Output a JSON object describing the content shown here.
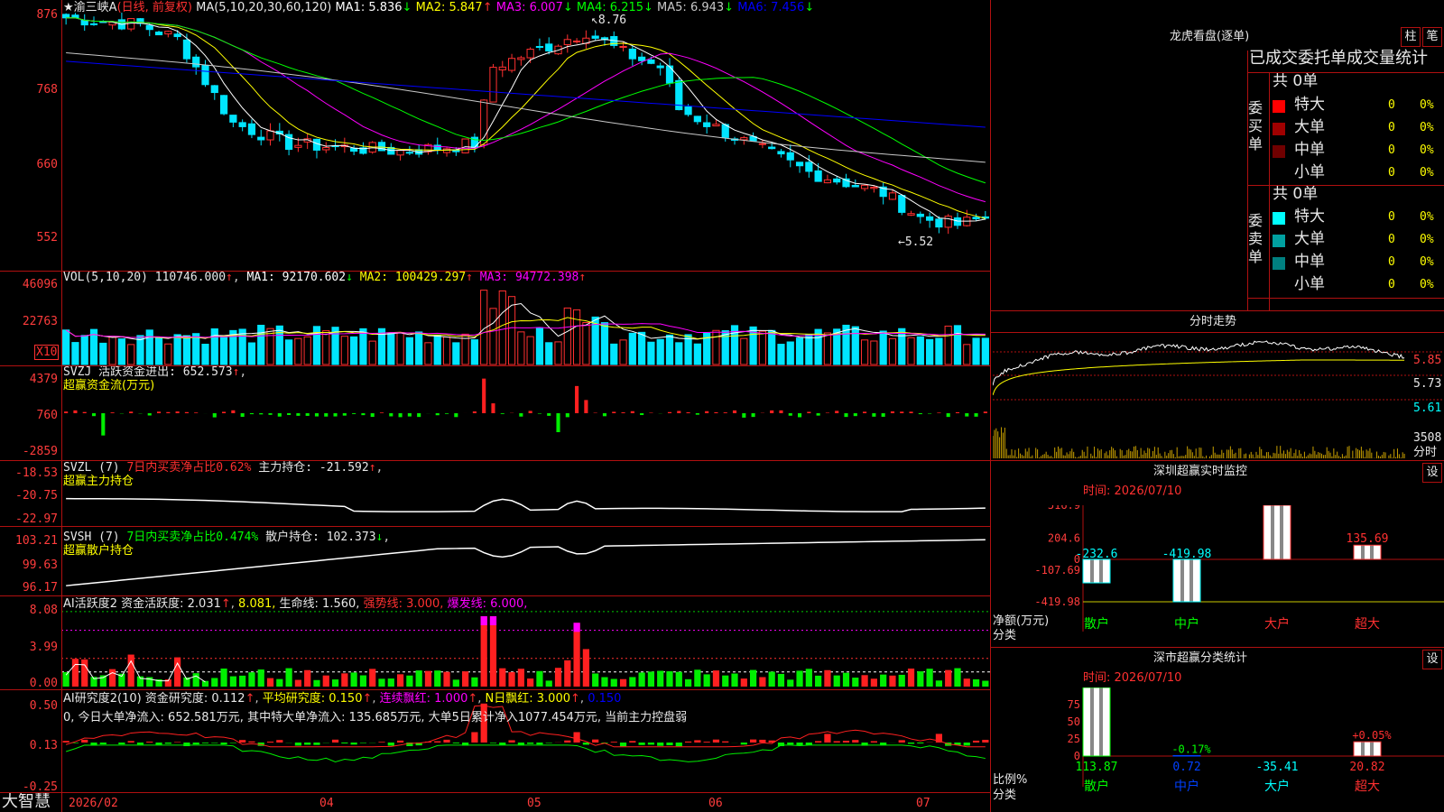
{
  "main": {
    "stock_title": "★渝三峡A",
    "period": "(日线, 前复权)",
    "ma_label": "MA(5,10,20,30,60,120)",
    "ma_values": [
      {
        "label": "MA1: 5.836",
        "arrow": "↓",
        "color": "#ffffff"
      },
      {
        "label": "MA2: 5.847",
        "arrow": "↑",
        "color": "#ffff00"
      },
      {
        "label": "MA3: 6.007",
        "arrow": "↓",
        "color": "#ff00ff"
      },
      {
        "label": "MA4: 6.215",
        "arrow": "↓",
        "color": "#00ff00"
      },
      {
        "label": "MA5: 6.943",
        "arrow": "↓",
        "color": "#c8c8c8"
      },
      {
        "label": "MA6: 7.456",
        "arrow": "↓",
        "color": "#0000ff"
      }
    ],
    "y_ticks": [
      "876",
      "768",
      "660",
      "552"
    ],
    "high_marker": "8.76",
    "low_marker": "5.52"
  },
  "vol": {
    "label": "VOL(5,10,20)",
    "value": "110746.000",
    "ma": [
      {
        "label": "MA1: 92170.602",
        "arrow": "↓",
        "color": "#ffffff"
      },
      {
        "label": "MA2: 100429.297",
        "arrow": "↑",
        "color": "#ffff00"
      },
      {
        "label": "MA3: 94772.398",
        "arrow": "↑",
        "color": "#ff00ff"
      }
    ],
    "y_ticks": [
      "46096",
      "22763"
    ],
    "unit": "X10"
  },
  "svzj": {
    "label": "SVZJ",
    "text": "活跃资金进出: 652.573",
    "sub": "超赢资金流(万元)",
    "y_ticks": [
      "4379",
      "760",
      "-2859"
    ]
  },
  "svzl": {
    "label": "SVZL (7)",
    "text1": "7日内买卖净占比0.62%",
    "text2": "主力持仓: -21.592",
    "sub": "超赢主力持仓",
    "y_ticks": [
      "-18.53",
      "-20.75",
      "-22.97"
    ]
  },
  "svsh": {
    "label": "SVSH (7)",
    "text1": "7日内买卖净占比0.474%",
    "text2": "散户持仓: 102.373",
    "sub": "超赢散户持仓",
    "y_ticks": [
      "103.21",
      "99.63",
      "96.17"
    ]
  },
  "ai1": {
    "label": "AI活跃度2",
    "t1": "资金活跃度: 2.031",
    "t2": "8.081,",
    "t3": "生命线: 1.560,",
    "t4": "强势线: 3.000,",
    "t5": "爆发线: 6.000,",
    "y_ticks": [
      "8.08",
      "3.99",
      "0.00"
    ]
  },
  "ai2": {
    "label": "AI研究度2(10)",
    "t1": "资金研究度: 0.112",
    "t2": "平均研究度: 0.150",
    "t3": "连续飘红: 1.000",
    "t4": "N日飘红: 3.000",
    "t5": "0.150",
    "desc": "0, 今日大单净流入: 652.581万元, 其中特大单净流入: 135.685万元, 大单5日累计净入1077.454万元, 当前主力控盘弱",
    "y_ticks": [
      "0.50",
      "0.13",
      "-0.25"
    ]
  },
  "x_axis": {
    "brand": "大智慧",
    "labels": [
      "2026/02",
      "04",
      "05",
      "06",
      "07"
    ]
  },
  "right": {
    "lhb_title": "龙虎看盘(逐单)",
    "btn_zhu": "柱",
    "btn_bi": "笔",
    "order_title": "已成交委托单成交量统计",
    "buy_side": "委买单",
    "sell_side": "委卖单",
    "buy_total": "共 0单",
    "sell_total": "共 0单",
    "buy_rows": [
      {
        "name": "特大",
        "count": "0",
        "pct": "0%",
        "color": "#ff0000"
      },
      {
        "name": "大单",
        "count": "0",
        "pct": "0%",
        "color": "#a00000"
      },
      {
        "name": "中单",
        "count": "0",
        "pct": "0%",
        "color": "#700000"
      },
      {
        "name": "小单",
        "count": "0",
        "pct": "0%",
        "color": "#000000"
      }
    ],
    "sell_rows": [
      {
        "name": "特大",
        "count": "0",
        "pct": "0%",
        "color": "#00ffff"
      },
      {
        "name": "大单",
        "count": "0",
        "pct": "0%",
        "color": "#00a0a0"
      },
      {
        "name": "中单",
        "count": "0",
        "pct": "0%",
        "color": "#008080"
      },
      {
        "name": "小单",
        "count": "0",
        "pct": "0%",
        "color": "#000000"
      }
    ],
    "intraday_title": "分时走势",
    "intraday_ticks": [
      "5.85",
      "5.73",
      "5.61"
    ],
    "intraday_vol": "3508",
    "intraday_unit": "分时",
    "sz_monitor_title": "深圳超赢实时监控",
    "sz_monitor_btn": "设",
    "monitor_time": "时间: 2026/07/10",
    "monitor_ticks": [
      "516.9",
      "204.6",
      "0",
      "-107.69",
      "-419.98"
    ],
    "monitor_values": [
      {
        "cat": "散户",
        "value": "-232.6"
      },
      {
        "cat": "中户",
        "value": "-419.98"
      },
      {
        "cat": "大户",
        "value": "516.9"
      },
      {
        "cat": "超大",
        "value": "135.69"
      }
    ],
    "monitor_ylabel": "净额(万元)",
    "monitor_xlabel": "分类",
    "class_title": "深市超赢分类统计",
    "class_btn": "设",
    "class_time": "时间: 2026/07/10",
    "class_ticks": [
      "75",
      "50",
      "25",
      "0"
    ],
    "class_values": [
      {
        "cat": "散户",
        "pct": "",
        "value": "113.87"
      },
      {
        "cat": "中户",
        "pct": "-0.17%",
        "value": "0.72"
      },
      {
        "cat": "大户",
        "pct": "",
        "value": "-35.41"
      },
      {
        "cat": "超大",
        "pct": "+0.05%",
        "value": "20.82"
      }
    ],
    "class_ylabel": "比例%",
    "class_xlabel": "分类"
  }
}
